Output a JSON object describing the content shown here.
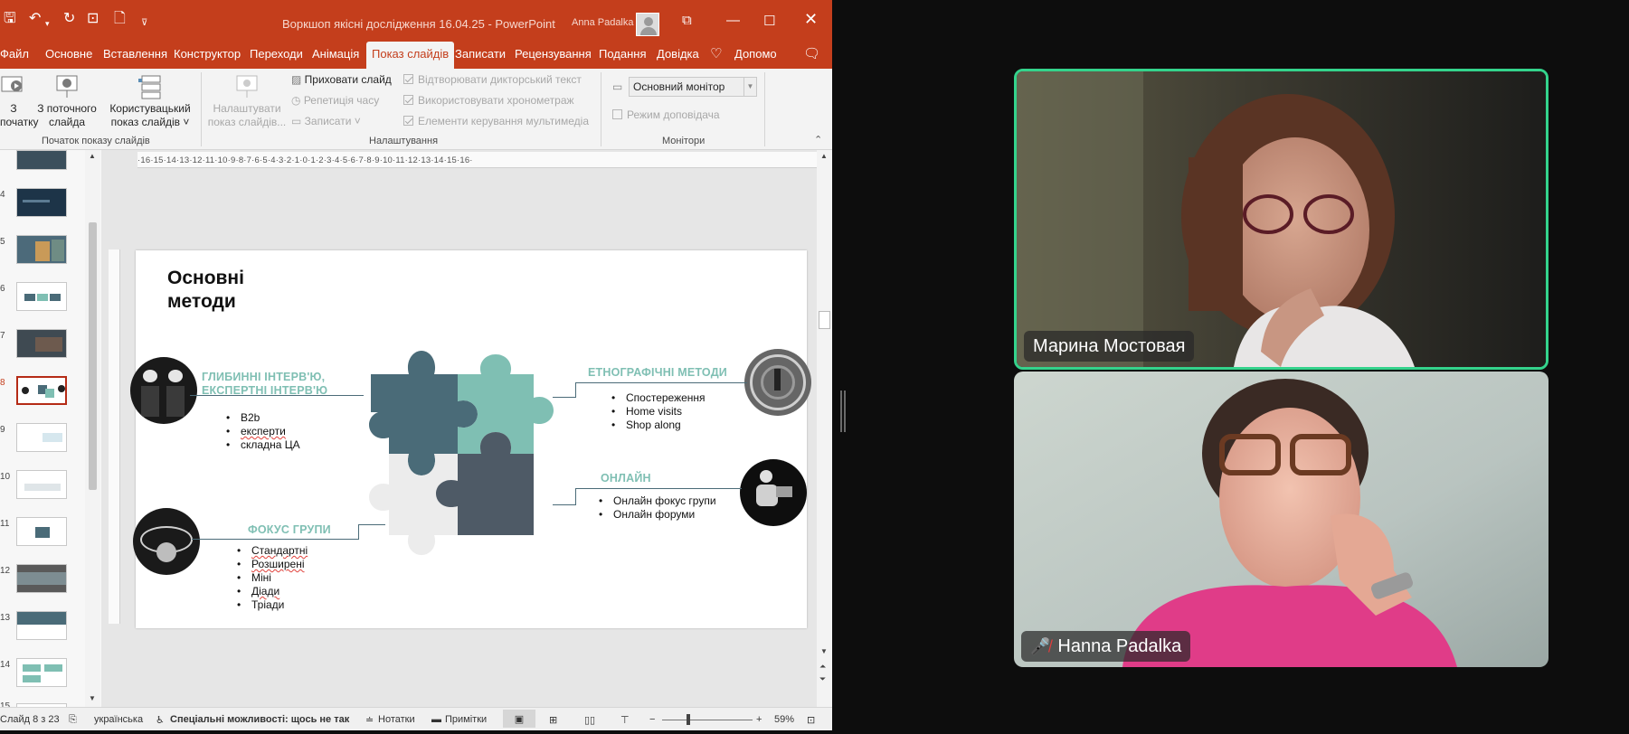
{
  "window": {
    "title": "Воркшоп якісні дослідження 16.04.25  -  PowerPoint",
    "user": "Anna Padalka"
  },
  "menu": [
    "Файл",
    "Основне",
    "Вставлення",
    "Конструктор",
    "Переходи",
    "Анімація",
    "Показ слайдів",
    "Записати",
    "Рецензування",
    "Подання",
    "Довідка",
    "Допомо"
  ],
  "ribbon": {
    "from_start": [
      "З",
      "початку"
    ],
    "from_current": [
      "З поточного",
      "слайда"
    ],
    "custom_show": [
      "Користувацький",
      "показ слайдів ˅"
    ],
    "group1_label": "Початок показу слайдів",
    "setup_show": [
      "Налаштувати",
      "показ слайдів..."
    ],
    "hide_slide": "Приховати слайд",
    "rehearse": "Репетиція часу",
    "record": "Записати",
    "play_narrations": "Відтворювати дикторський текст",
    "use_timings": "Використовувати хронометраж",
    "media_controls": "Елементи керування мультимедіа",
    "group2_label": "Налаштування",
    "monitor_value": "Основний монітор",
    "presenter_view": "Режим доповідача",
    "group3_label": "Монітори"
  },
  "thumbnails": {
    "numbers": [
      "",
      "4",
      "5",
      "6",
      "7",
      "8",
      "9",
      "10",
      "11",
      "12",
      "13",
      "14",
      "15"
    ],
    "selected_index": 5
  },
  "ruler": {
    "h": "·16·15·14·13·12·11·10·9·8·7·6·5·4·3·2·1·0·1·2·3·4·5·6·7·8·9·10·11·12·13·14·15·16·"
  },
  "slide": {
    "title_line1": "Основні",
    "title_line2": "методи",
    "deep_heading_1": "ГЛИБИННІ ІНТЕРВ'Ю,",
    "deep_heading_2": "ЕКСПЕРТНІ ІНТЕРВ'Ю",
    "deep_items": [
      "B2b",
      "експерти",
      "складна ЦА"
    ],
    "focus_heading": "ФОКУС ГРУПИ",
    "focus_items": [
      "Стандартні",
      "Розширені",
      "Міні",
      "Діади",
      "Тріади"
    ],
    "ethno_heading": "ЕТНОГРАФІЧНІ МЕТОДИ",
    "ethno_items": [
      "Спостереження",
      "Home visits",
      "Shop along"
    ],
    "online_heading": "ОНЛАЙН",
    "online_items": [
      "Онлайн фокус групи",
      "Онлайн форуми"
    ]
  },
  "status": {
    "slide_count": "Слайд 8 з 23",
    "language": "українська",
    "accessibility": "Спеціальні можливості: щось не так",
    "notes": "Нотатки",
    "comments": "Примітки",
    "zoom": "59%"
  },
  "participants": [
    {
      "name": "Марина Мостовая",
      "speaking": true
    },
    {
      "name": "Hanna Padalka",
      "muted": true
    }
  ],
  "colors": {
    "ppt_accent": "#c43e1c",
    "active_speaker": "#34d38c",
    "slide_teal": "#7fbfb3",
    "puzzle_dark": "#4a6b78",
    "puzzle_teal": "#7fbfb3",
    "puzzle_light": "#ececec",
    "puzzle_navy": "#4e5a66"
  }
}
